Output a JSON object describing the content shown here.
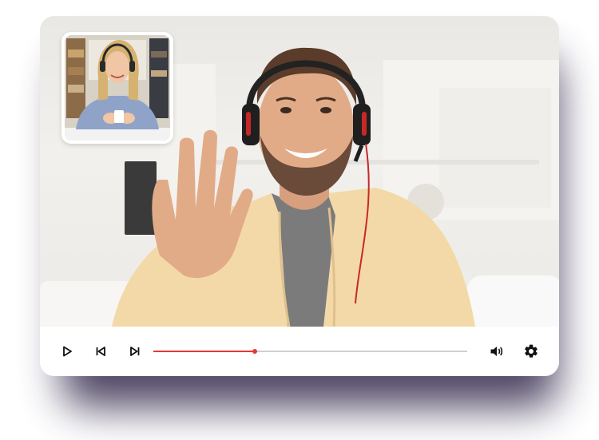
{
  "player": {
    "accent_color": "#e53935",
    "track_color": "#cfcfcf",
    "shadow_color": "#2f2548",
    "progress_fraction": 0.324
  },
  "controls": {
    "play_icon": "play-icon",
    "previous_icon": "skip-previous-icon",
    "next_icon": "skip-next-icon",
    "volume_icon": "volume-icon",
    "settings_icon": "gear-icon"
  }
}
